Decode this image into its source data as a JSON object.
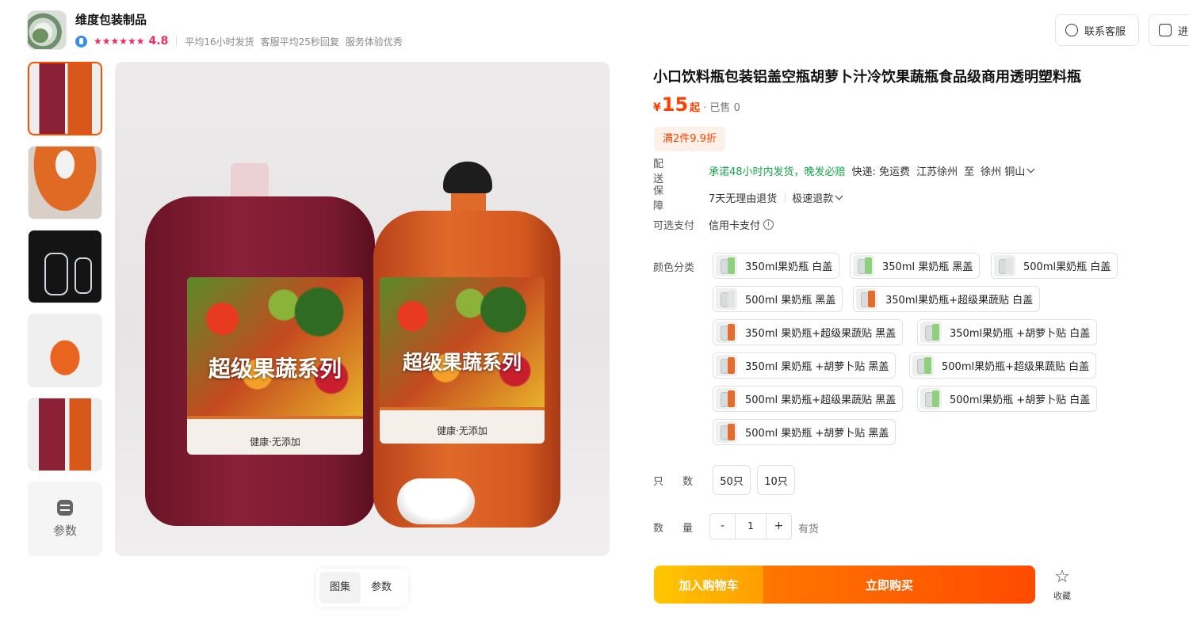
{
  "shop": {
    "name": "维度包装制品",
    "stars": "★★★★★★",
    "rating": "4.8",
    "meta": [
      "平均16小时发货",
      "客服平均25秒回复",
      "服务体验优秀"
    ],
    "contact_label": "联系客服",
    "enter_label": "进"
  },
  "gallery": {
    "tabs": [
      "图集",
      "参数"
    ],
    "params_thumb_label": "参数",
    "label_title": "超级果蔬系列",
    "label_sub": "健康·无添加"
  },
  "product": {
    "title": "小口饮料瓶包装铝盖空瓶胡萝卜汁冷饮果蔬瓶食品级商用透明塑料瓶",
    "price_symbol": "¥",
    "price": "15",
    "price_suffix": "起",
    "sold": "· 已售 0",
    "promo": "满2件9.9折"
  },
  "shipping": {
    "label": "配送",
    "promise": "承诺48小时内发货，晚发必赔",
    "fee": "快递: 免运费",
    "from": "江苏徐州",
    "to_word": "至",
    "dest": "徐州 铜山"
  },
  "guarantee": {
    "label": "保障",
    "item1": "7天无理由退货",
    "item2": "极速退款"
  },
  "payment": {
    "label": "可选支付",
    "method": "信用卡支付",
    "info": "i"
  },
  "sku": {
    "label": "颜色分类",
    "options": [
      {
        "text": "350ml果奶瓶 白盖",
        "sw": "g"
      },
      {
        "text": "350ml 果奶瓶 黑盖",
        "sw": "g"
      },
      {
        "text": "500ml果奶瓶 白盖",
        "sw": "w"
      },
      {
        "text": "500ml 果奶瓶 黑盖",
        "sw": "w"
      },
      {
        "text": "350ml果奶瓶+超级果蔬贴 白盖",
        "sw": "o"
      },
      {
        "text": "350ml 果奶瓶+超级果蔬贴 黑盖",
        "sw": "o"
      },
      {
        "text": "350ml果奶瓶 +胡萝卜贴 白盖",
        "sw": "g"
      },
      {
        "text": "350ml 果奶瓶 +胡萝卜贴 黑盖",
        "sw": "o"
      },
      {
        "text": "500ml果奶瓶+超级果蔬贴 白盖",
        "sw": "g"
      },
      {
        "text": "500ml 果奶瓶+超级果蔬贴 黑盖",
        "sw": "o"
      },
      {
        "text": "500ml果奶瓶 +胡萝卜贴 白盖",
        "sw": "g"
      },
      {
        "text": "500ml 果奶瓶 +胡萝卜贴 黑盖",
        "sw": "o"
      }
    ]
  },
  "count": {
    "label": "只数",
    "options": [
      "50只",
      "10只"
    ]
  },
  "quantity": {
    "label": "数量",
    "minus": "-",
    "value": "1",
    "plus": "+",
    "stock": "有货"
  },
  "actions": {
    "cart": "加入购物车",
    "buy": "立即购买",
    "fav": "收藏",
    "fav_icon": "☆"
  },
  "colors": {
    "accent": "#ff4000",
    "green": "#16a34a"
  }
}
